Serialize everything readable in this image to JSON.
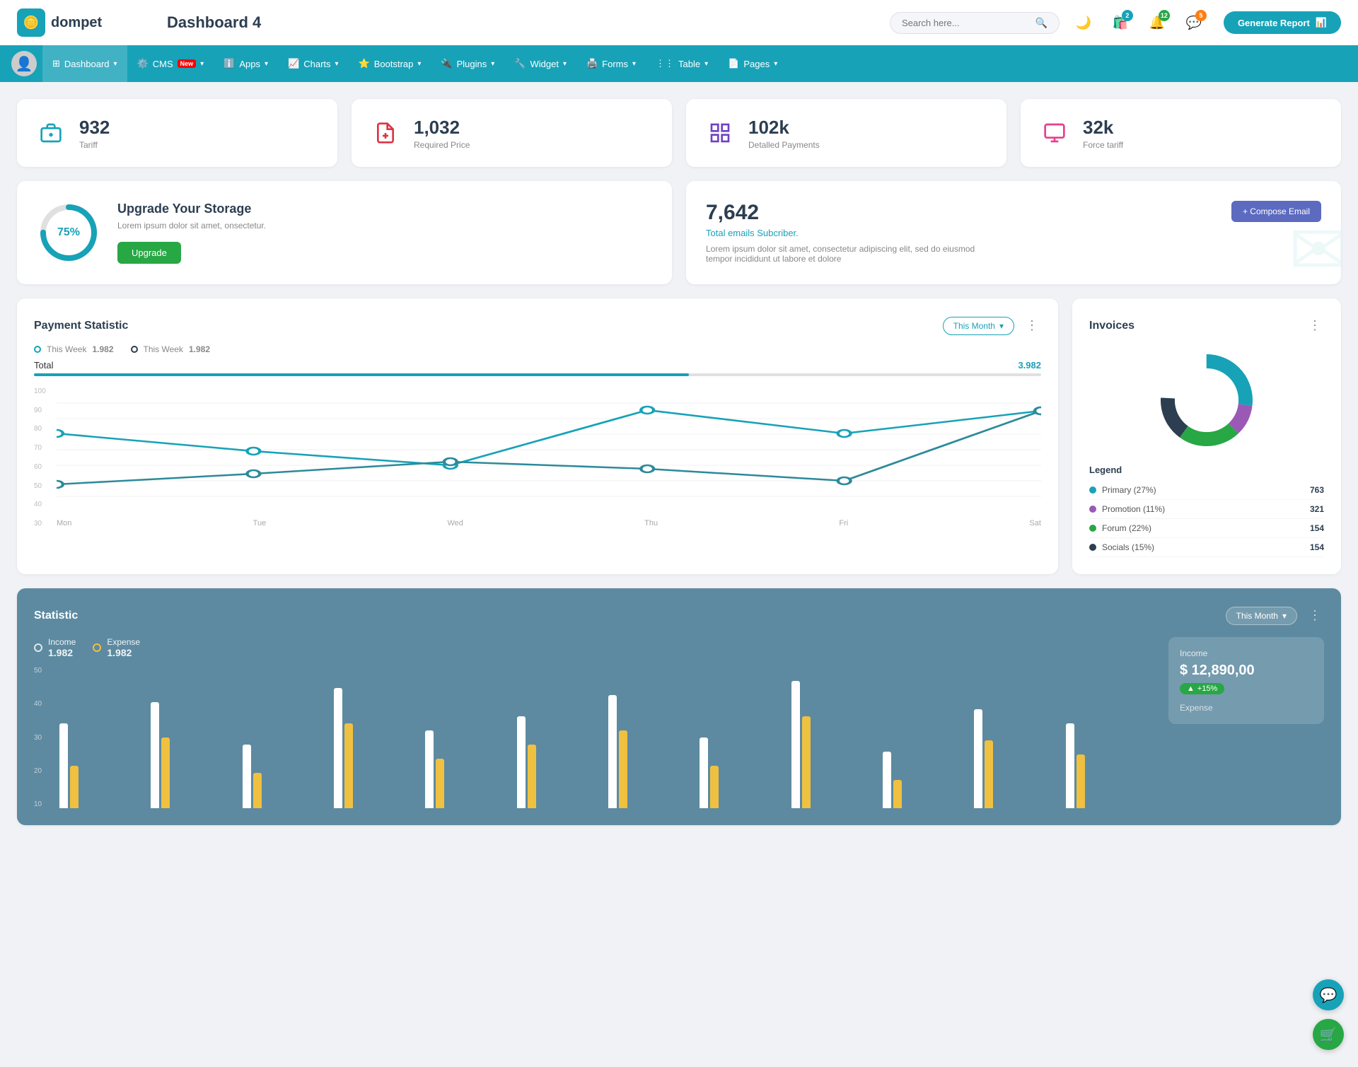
{
  "header": {
    "logo_text": "dompet",
    "page_title": "Dashboard 4",
    "search_placeholder": "Search here...",
    "generate_btn": "Generate Report",
    "icons": {
      "shop_badge": "2",
      "bell_badge": "12",
      "chat_badge": "5"
    }
  },
  "navbar": {
    "items": [
      {
        "label": "Dashboard",
        "active": true,
        "has_arrow": true
      },
      {
        "label": "CMS",
        "active": false,
        "has_arrow": true,
        "badge": "New"
      },
      {
        "label": "Apps",
        "active": false,
        "has_arrow": true
      },
      {
        "label": "Charts",
        "active": false,
        "has_arrow": true
      },
      {
        "label": "Bootstrap",
        "active": false,
        "has_arrow": true
      },
      {
        "label": "Plugins",
        "active": false,
        "has_arrow": true
      },
      {
        "label": "Widget",
        "active": false,
        "has_arrow": true
      },
      {
        "label": "Forms",
        "active": false,
        "has_arrow": true
      },
      {
        "label": "Table",
        "active": false,
        "has_arrow": true
      },
      {
        "label": "Pages",
        "active": false,
        "has_arrow": true
      }
    ]
  },
  "stat_cards": [
    {
      "value": "932",
      "label": "Tariff",
      "icon": "briefcase",
      "icon_color": "teal"
    },
    {
      "value": "1,032",
      "label": "Required Price",
      "icon": "file",
      "icon_color": "red"
    },
    {
      "value": "102k",
      "label": "Detalled Payments",
      "icon": "grid",
      "icon_color": "purple"
    },
    {
      "value": "32k",
      "label": "Force tariff",
      "icon": "box",
      "icon_color": "pink"
    }
  ],
  "storage": {
    "percent": 75,
    "title": "Upgrade Your Storage",
    "description": "Lorem ipsum dolor sit amet, onsectetur.",
    "btn_label": "Upgrade"
  },
  "email": {
    "count": "7,642",
    "subtitle": "Total emails Subcriber.",
    "description": "Lorem ipsum dolor sit amet, consectetur adipiscing elit, sed do eiusmod tempor incididunt ut labore et dolore",
    "compose_btn": "+ Compose Email"
  },
  "payment": {
    "title": "Payment Statistic",
    "filter": "This Month",
    "legend": [
      {
        "label": "This Week",
        "value": "1.982",
        "color": "teal"
      },
      {
        "label": "This Week",
        "value": "1.982",
        "color": "dark"
      }
    ],
    "total_label": "Total",
    "total_value": "3.982",
    "x_labels": [
      "Mon",
      "Tue",
      "Wed",
      "Thu",
      "Fri",
      "Sat"
    ],
    "y_labels": [
      "100",
      "90",
      "80",
      "70",
      "60",
      "50",
      "40",
      "30"
    ],
    "line1_points": "0,65 100,55 200,42 300,78 400,62 500,37 600,38",
    "line2_points": "0,60 100,68 200,58 300,40 400,65 500,37 600,38"
  },
  "invoices": {
    "title": "Invoices",
    "legend": [
      {
        "label": "Primary (27%)",
        "value": "763",
        "color": "#17a2b8"
      },
      {
        "label": "Promotion (11%)",
        "value": "321",
        "color": "#9b59b6"
      },
      {
        "label": "Forum (22%)",
        "value": "154",
        "color": "#28a745"
      },
      {
        "label": "Socials (15%)",
        "value": "154",
        "color": "#2c3e50"
      }
    ],
    "legend_title": "Legend"
  },
  "statistic": {
    "title": "Statistic",
    "filter": "This Month",
    "income": {
      "label": "Income",
      "value": "1.982"
    },
    "expense": {
      "label": "Expense",
      "value": "1.982"
    },
    "income_box": {
      "label": "Income",
      "amount": "$ 12,890,00",
      "change": "+15%"
    },
    "expense_label": "Expense",
    "y_labels": [
      "50",
      "40",
      "30",
      "20",
      "10"
    ],
    "bars": [
      {
        "white": 60,
        "yellow": 30
      },
      {
        "white": 75,
        "yellow": 50
      },
      {
        "white": 45,
        "yellow": 25
      },
      {
        "white": 85,
        "yellow": 60
      },
      {
        "white": 55,
        "yellow": 35
      },
      {
        "white": 65,
        "yellow": 45
      },
      {
        "white": 80,
        "yellow": 55
      },
      {
        "white": 50,
        "yellow": 30
      },
      {
        "white": 90,
        "yellow": 65
      },
      {
        "white": 40,
        "yellow": 20
      },
      {
        "white": 70,
        "yellow": 48
      },
      {
        "white": 60,
        "yellow": 38
      }
    ]
  }
}
